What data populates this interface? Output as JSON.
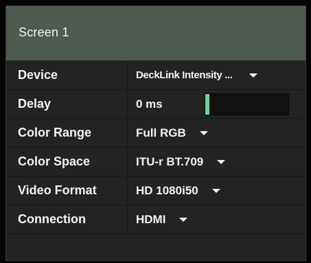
{
  "screen": {
    "title": "Screen 1"
  },
  "rows": [
    {
      "label": "Device",
      "value": "DeckLink Intensity ...",
      "control": "dropdown",
      "icon": "chevron-down-icon"
    },
    {
      "label": "Delay",
      "value": "0 ms",
      "control": "meter",
      "level": 0.05,
      "fill_color": "#6fd39f"
    },
    {
      "label": "Color Range",
      "value": "Full RGB",
      "control": "dropdown",
      "icon": "chevron-down-icon"
    },
    {
      "label": "Color Space",
      "value": "ITU-r BT.709",
      "control": "dropdown",
      "icon": "chevron-down-icon"
    },
    {
      "label": "Video Format",
      "value": "HD 1080i50",
      "control": "dropdown",
      "icon": "chevron-down-icon"
    },
    {
      "label": "Connection",
      "value": "HDMI",
      "control": "dropdown",
      "icon": "chevron-down-icon"
    }
  ],
  "colors": {
    "background": "#050505",
    "panel": "#232323",
    "header": "#4f5a50",
    "text": "#f3f3f3",
    "accent": "#6fd39f"
  }
}
